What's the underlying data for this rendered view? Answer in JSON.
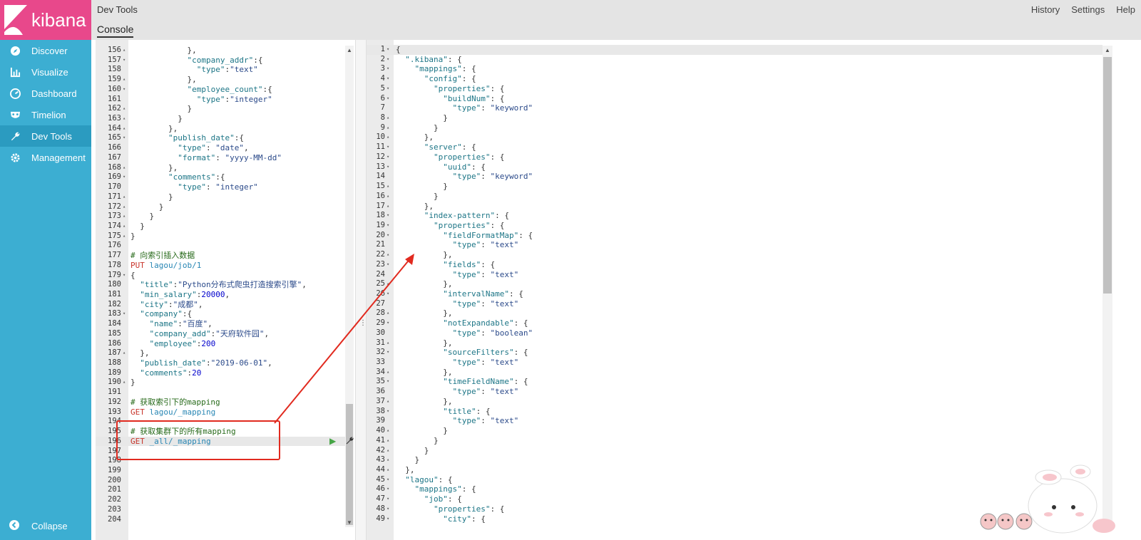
{
  "brand": {
    "name": "kibana",
    "bg": "#e8488b",
    "sidebar_bg": "#3caed2"
  },
  "nav": [
    {
      "label": "Discover",
      "icon": "compass-icon"
    },
    {
      "label": "Visualize",
      "icon": "bar-chart-icon"
    },
    {
      "label": "Dashboard",
      "icon": "gauge-icon"
    },
    {
      "label": "Timelion",
      "icon": "mask-icon"
    },
    {
      "label": "Dev Tools",
      "icon": "wrench-icon",
      "active": true
    },
    {
      "label": "Management",
      "icon": "gear-icon"
    }
  ],
  "collapse_label": "Collapse",
  "header": {
    "title": "Dev Tools",
    "tab": "Console",
    "links": [
      "History",
      "Settings",
      "Help"
    ]
  },
  "left_editor": {
    "lines": [
      {
        "n": "156",
        "f": "▴",
        "c": "            },"
      },
      {
        "n": "157",
        "f": "▾",
        "c": "            \"company_addr\":{"
      },
      {
        "n": "158",
        "f": "",
        "c": "              \"type\":\"text\""
      },
      {
        "n": "159",
        "f": "▴",
        "c": "            },"
      },
      {
        "n": "160",
        "f": "▾",
        "c": "            \"employee_count\":{"
      },
      {
        "n": "161",
        "f": "",
        "c": "              \"type\":\"integer\""
      },
      {
        "n": "162",
        "f": "▴",
        "c": "            }"
      },
      {
        "n": "163",
        "f": "▴",
        "c": "          }"
      },
      {
        "n": "164",
        "f": "▴",
        "c": "        },"
      },
      {
        "n": "165",
        "f": "▾",
        "c": "        \"publish_date\":{"
      },
      {
        "n": "166",
        "f": "",
        "c": "          \"type\": \"date\","
      },
      {
        "n": "167",
        "f": "",
        "c": "          \"format\": \"yyyy-MM-dd\""
      },
      {
        "n": "168",
        "f": "▴",
        "c": "        },"
      },
      {
        "n": "169",
        "f": "▾",
        "c": "        \"comments\":{"
      },
      {
        "n": "170",
        "f": "",
        "c": "          \"type\": \"integer\""
      },
      {
        "n": "171",
        "f": "▴",
        "c": "        }"
      },
      {
        "n": "172",
        "f": "▴",
        "c": "      }"
      },
      {
        "n": "173",
        "f": "▴",
        "c": "    }"
      },
      {
        "n": "174",
        "f": "▴",
        "c": "  }"
      },
      {
        "n": "175",
        "f": "▴",
        "c": "}"
      },
      {
        "n": "176",
        "f": "",
        "c": ""
      },
      {
        "n": "177",
        "f": "",
        "c": "# 向索引插入数据",
        "t": "cm"
      },
      {
        "n": "178",
        "f": "",
        "c": "PUT lagou/job/1",
        "t": "req"
      },
      {
        "n": "179",
        "f": "▾",
        "c": "{"
      },
      {
        "n": "180",
        "f": "",
        "c": "  \"title\":\"Python分布式爬虫打造搜索引擎\","
      },
      {
        "n": "181",
        "f": "",
        "c": "  \"min_salary\":20000,"
      },
      {
        "n": "182",
        "f": "",
        "c": "  \"city\":\"成都\","
      },
      {
        "n": "183",
        "f": "▾",
        "c": "  \"company\":{"
      },
      {
        "n": "184",
        "f": "",
        "c": "    \"name\":\"百度\","
      },
      {
        "n": "185",
        "f": "",
        "c": "    \"company_add\":\"天府软件园\","
      },
      {
        "n": "186",
        "f": "",
        "c": "    \"employee\":200"
      },
      {
        "n": "187",
        "f": "▴",
        "c": "  },"
      },
      {
        "n": "188",
        "f": "",
        "c": "  \"publish_date\":\"2019-06-01\","
      },
      {
        "n": "189",
        "f": "",
        "c": "  \"comments\":20"
      },
      {
        "n": "190",
        "f": "▴",
        "c": "}"
      },
      {
        "n": "191",
        "f": "",
        "c": ""
      },
      {
        "n": "192",
        "f": "",
        "c": "# 获取索引下的mapping",
        "t": "cm"
      },
      {
        "n": "193",
        "f": "",
        "c": "GET lagou/_mapping",
        "t": "req"
      },
      {
        "n": "194",
        "f": "",
        "c": ""
      },
      {
        "n": "195",
        "f": "",
        "c": "# 获取集群下的所有mapping",
        "t": "cm"
      },
      {
        "n": "196",
        "f": "",
        "c": "GET _all/_mapping",
        "t": "req",
        "hl": true
      },
      {
        "n": "197",
        "f": "",
        "c": ""
      },
      {
        "n": "198",
        "f": "",
        "c": ""
      },
      {
        "n": "199",
        "f": "",
        "c": ""
      },
      {
        "n": "200",
        "f": "",
        "c": ""
      },
      {
        "n": "201",
        "f": "",
        "c": ""
      },
      {
        "n": "202",
        "f": "",
        "c": ""
      },
      {
        "n": "203",
        "f": "",
        "c": ""
      },
      {
        "n": "204",
        "f": "",
        "c": ""
      }
    ]
  },
  "right_editor": {
    "lines": [
      {
        "n": "1",
        "f": "▾",
        "c": "{",
        "hl": true
      },
      {
        "n": "2",
        "f": "▾",
        "c": "  \".kibana\": {"
      },
      {
        "n": "3",
        "f": "▾",
        "c": "    \"mappings\": {"
      },
      {
        "n": "4",
        "f": "▾",
        "c": "      \"config\": {"
      },
      {
        "n": "5",
        "f": "▾",
        "c": "        \"properties\": {"
      },
      {
        "n": "6",
        "f": "▾",
        "c": "          \"buildNum\": {"
      },
      {
        "n": "7",
        "f": "",
        "c": "            \"type\": \"keyword\""
      },
      {
        "n": "8",
        "f": "▴",
        "c": "          }"
      },
      {
        "n": "9",
        "f": "▴",
        "c": "        }"
      },
      {
        "n": "10",
        "f": "▴",
        "c": "      },"
      },
      {
        "n": "11",
        "f": "▾",
        "c": "      \"server\": {"
      },
      {
        "n": "12",
        "f": "▾",
        "c": "        \"properties\": {"
      },
      {
        "n": "13",
        "f": "▾",
        "c": "          \"uuid\": {"
      },
      {
        "n": "14",
        "f": "",
        "c": "            \"type\": \"keyword\""
      },
      {
        "n": "15",
        "f": "▴",
        "c": "          }"
      },
      {
        "n": "16",
        "f": "▴",
        "c": "        }"
      },
      {
        "n": "17",
        "f": "▴",
        "c": "      },"
      },
      {
        "n": "18",
        "f": "▾",
        "c": "      \"index-pattern\": {"
      },
      {
        "n": "19",
        "f": "▾",
        "c": "        \"properties\": {"
      },
      {
        "n": "20",
        "f": "▾",
        "c": "          \"fieldFormatMap\": {"
      },
      {
        "n": "21",
        "f": "",
        "c": "            \"type\": \"text\""
      },
      {
        "n": "22",
        "f": "▴",
        "c": "          },"
      },
      {
        "n": "23",
        "f": "▾",
        "c": "          \"fields\": {"
      },
      {
        "n": "24",
        "f": "",
        "c": "            \"type\": \"text\""
      },
      {
        "n": "25",
        "f": "▴",
        "c": "          },"
      },
      {
        "n": "26",
        "f": "▾",
        "c": "          \"intervalName\": {"
      },
      {
        "n": "27",
        "f": "",
        "c": "            \"type\": \"text\""
      },
      {
        "n": "28",
        "f": "▴",
        "c": "          },"
      },
      {
        "n": "29",
        "f": "▾",
        "c": "          \"notExpandable\": {"
      },
      {
        "n": "30",
        "f": "",
        "c": "            \"type\": \"boolean\""
      },
      {
        "n": "31",
        "f": "▴",
        "c": "          },"
      },
      {
        "n": "32",
        "f": "▾",
        "c": "          \"sourceFilters\": {"
      },
      {
        "n": "33",
        "f": "",
        "c": "            \"type\": \"text\""
      },
      {
        "n": "34",
        "f": "▴",
        "c": "          },"
      },
      {
        "n": "35",
        "f": "▾",
        "c": "          \"timeFieldName\": {"
      },
      {
        "n": "36",
        "f": "",
        "c": "            \"type\": \"text\""
      },
      {
        "n": "37",
        "f": "▴",
        "c": "          },"
      },
      {
        "n": "38",
        "f": "▾",
        "c": "          \"title\": {"
      },
      {
        "n": "39",
        "f": "",
        "c": "            \"type\": \"text\""
      },
      {
        "n": "40",
        "f": "▴",
        "c": "          }"
      },
      {
        "n": "41",
        "f": "▴",
        "c": "        }"
      },
      {
        "n": "42",
        "f": "▴",
        "c": "      }"
      },
      {
        "n": "43",
        "f": "▴",
        "c": "    }"
      },
      {
        "n": "44",
        "f": "▴",
        "c": "  },"
      },
      {
        "n": "45",
        "f": "▾",
        "c": "  \"lagou\": {"
      },
      {
        "n": "46",
        "f": "▾",
        "c": "    \"mappings\": {"
      },
      {
        "n": "47",
        "f": "▾",
        "c": "      \"job\": {"
      },
      {
        "n": "48",
        "f": "▾",
        "c": "        \"properties\": {"
      },
      {
        "n": "49",
        "f": "▾",
        "c": "          \"city\": {"
      }
    ]
  }
}
